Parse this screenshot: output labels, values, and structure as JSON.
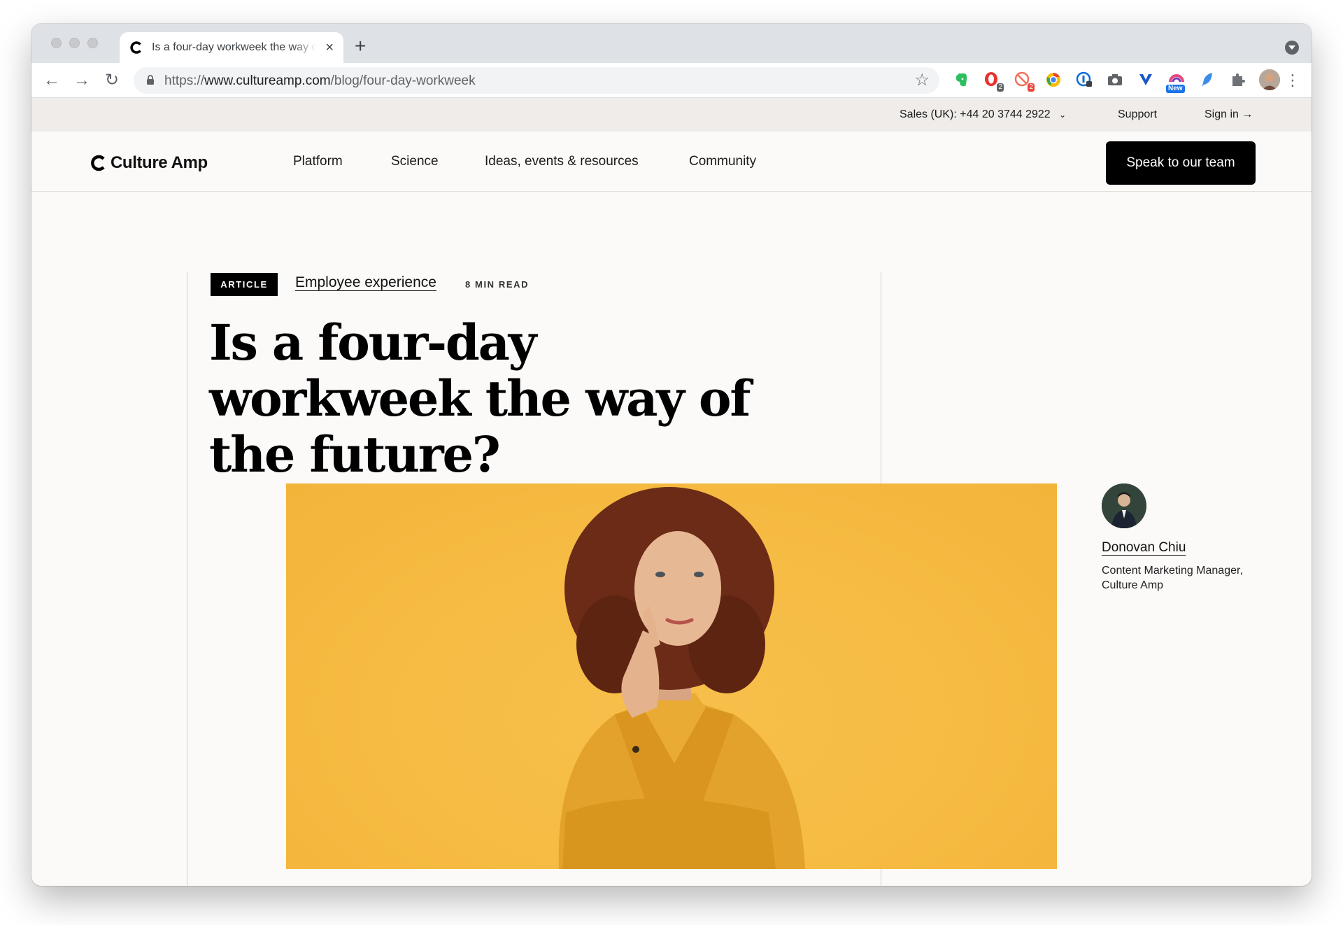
{
  "browser": {
    "tab_title": "Is a four-day workweek the way of the future? | Culture Amp",
    "url_prefix": "https://",
    "url_domain": "www.cultureamp.com",
    "url_path": "/blog/four-day-workweek",
    "extensions": [
      {
        "name": "evernote-icon",
        "color": "#2dbe60"
      },
      {
        "name": "opera-icon",
        "color": "#e8322f",
        "badge": "2"
      },
      {
        "name": "block-icon",
        "color": "#f0715b",
        "badge": "2"
      },
      {
        "name": "google-chrome-icon",
        "color": "#fbbc05"
      },
      {
        "name": "onepassword-icon",
        "color": "#0a6bd6"
      },
      {
        "name": "camera-icon",
        "color": "#5f6368"
      },
      {
        "name": "vivaldi-icon",
        "color": "#1a57c9"
      },
      {
        "name": "new-extension-icon",
        "color": "#e64a7a",
        "badge": "New"
      },
      {
        "name": "feather-icon",
        "color": "#3b8ee8"
      },
      {
        "name": "puzzle-icon",
        "color": "#5f6368"
      }
    ]
  },
  "utility_bar": {
    "sales": "Sales (UK): +44 20 3744 2922",
    "support": "Support",
    "signin": "Sign in →"
  },
  "nav": {
    "logo": "Culture Amp",
    "items": [
      "Platform",
      "Science",
      "Ideas, events & resources",
      "Community"
    ],
    "cta": "Speak to our team"
  },
  "article": {
    "type_badge": "ARTICLE",
    "category": "Employee experience",
    "read_time": "8 MIN READ",
    "title": "Is a four-day workweek the way of the future?"
  },
  "author": {
    "name": "Donovan Chiu",
    "title": "Content Marketing Manager, Culture Amp"
  },
  "colors": {
    "page_bg": "#fcfaf8",
    "utility_bg": "#efece9",
    "hero_bg": "#f6bb43",
    "cta_bg": "#000000"
  }
}
